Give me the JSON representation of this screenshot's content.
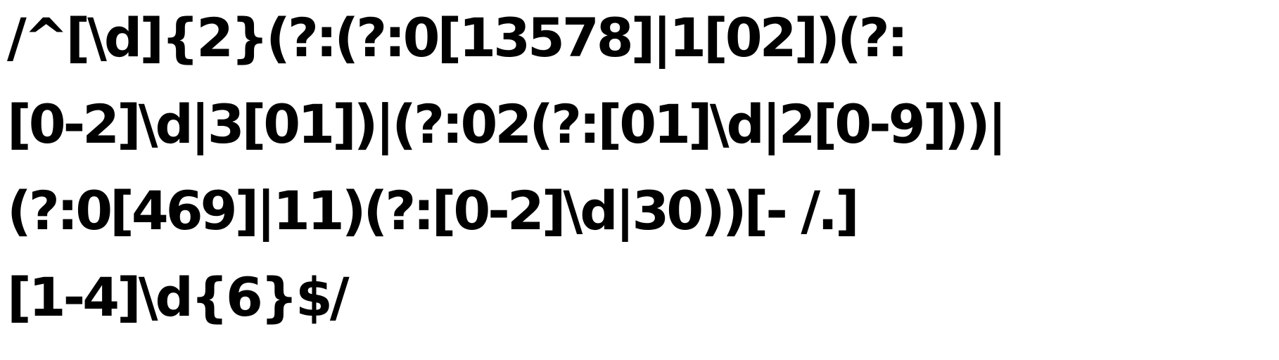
{
  "regex": {
    "lines": [
      "/^[\\d]{2}(?:(?:0[13578]|1[02])(?:",
      "[0-2]\\d|3[01])|(?:02(?:[01]\\d|2[0-9]))|",
      "(?:0[469]|11)(?:[0-2]\\d|30))[- /.]",
      "[1-4]\\d{6}$/"
    ]
  },
  "colors": {
    "text": "#000000",
    "background": "#ffffff"
  }
}
